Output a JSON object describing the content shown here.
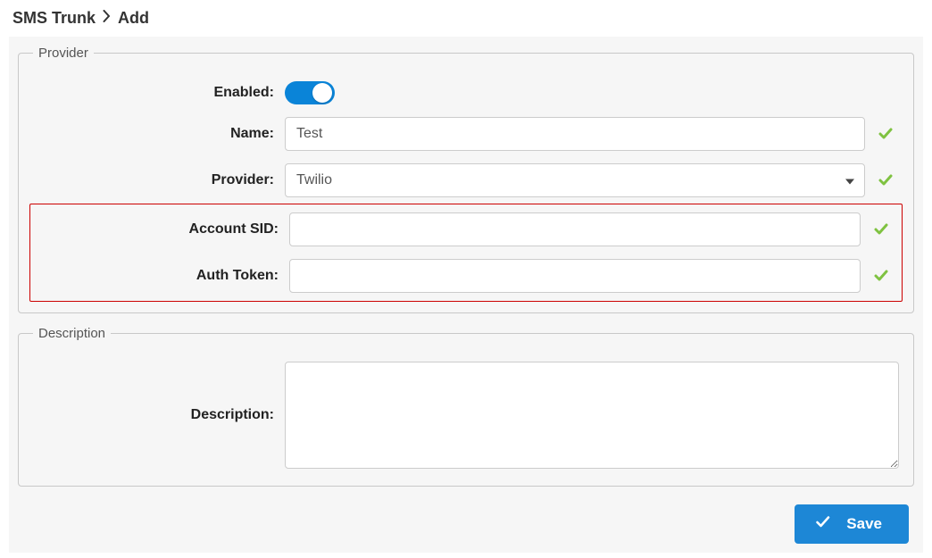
{
  "breadcrumb": {
    "root": "SMS Trunk",
    "current": "Add"
  },
  "sections": {
    "provider": {
      "legend": "Provider",
      "enabled_label": "Enabled:",
      "enabled_value": true,
      "name_label": "Name:",
      "name_value": "Test",
      "provider_label": "Provider:",
      "provider_value": "Twilio",
      "account_sid_label": "Account SID:",
      "account_sid_value": "",
      "auth_token_label": "Auth Token:",
      "auth_token_value": ""
    },
    "description": {
      "legend": "Description",
      "description_label": "Description:",
      "description_value": ""
    }
  },
  "buttons": {
    "save": "Save"
  },
  "colors": {
    "accent": "#1d87d6",
    "valid": "#7fc241",
    "highlight": "#c00"
  }
}
